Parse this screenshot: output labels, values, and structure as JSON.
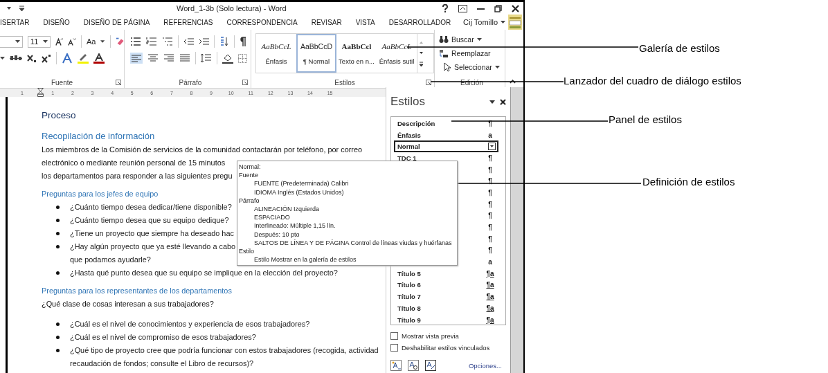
{
  "window": {
    "title": "Word_1-3b (Solo lectura) - Word"
  },
  "tabs": [
    {
      "label": "ISERTAR",
      "selected": false
    },
    {
      "label": "DISEÑO",
      "selected": false
    },
    {
      "label": "DISEÑO DE PÁGINA",
      "selected": false
    },
    {
      "label": "REFERENCIAS",
      "selected": false
    },
    {
      "label": "CORRESPONDENCIA",
      "selected": false
    },
    {
      "label": "REVISAR",
      "selected": false
    },
    {
      "label": "VISTA",
      "selected": false
    },
    {
      "label": "DESARROLLADOR",
      "selected": false
    }
  ],
  "user": {
    "name": "Cij Tomillo"
  },
  "ribbon": {
    "font_size": "11",
    "change_case": "Aa",
    "groups": [
      "Fuente",
      "Párrafo",
      "Estilos",
      "Edición"
    ],
    "gallery": [
      {
        "preview": "AaBbCcL",
        "label": "Énfasis",
        "kind": "italic",
        "selected": false
      },
      {
        "preview": "AaBbCcD",
        "label": "¶ Normal",
        "kind": "normal",
        "selected": true
      },
      {
        "preview": "AaBbCcl",
        "label": "Texto en n...",
        "kind": "bold",
        "selected": false
      },
      {
        "preview": "AaBbCcL",
        "label": "Énfasis sutil",
        "kind": "italic",
        "selected": false
      }
    ],
    "editing": [
      {
        "label": "Buscar",
        "kind": "find",
        "dropdown": true
      },
      {
        "label": "Reemplazar",
        "kind": "replace",
        "dropdown": false
      },
      {
        "label": "Seleccionar",
        "kind": "select",
        "dropdown": true
      }
    ]
  },
  "ruler": [
    "1",
    "1",
    "2",
    "3",
    "4",
    "5",
    "6",
    "7",
    "8",
    "9",
    "10",
    "11",
    "12",
    "13",
    "14",
    "15"
  ],
  "document": [
    {
      "kind": "title",
      "lines": [
        "Proceso"
      ]
    },
    {
      "kind": "heading",
      "lines": [
        "Recopilación de información"
      ]
    },
    {
      "kind": "para",
      "lines": [
        "Los miembros de la Comisión de servicios de la comunidad contactarán por teléfono, por correo",
        "electrónico o mediante reunión personal de 15 minutos",
        "los departamentos para responder a las siguientes pregu"
      ]
    },
    {
      "kind": "subheading",
      "lines": [
        "Preguntas para los jefes de equipo"
      ]
    },
    {
      "kind": "bullet",
      "lines": [
        "¿Cuánto tiempo desea dedicar/tiene disponible?"
      ]
    },
    {
      "kind": "bullet",
      "lines": [
        "¿Cuánto tiempo desea que su equipo dedique?"
      ]
    },
    {
      "kind": "bullet",
      "lines": [
        "¿Tiene un proyecto que siempre ha deseado hac"
      ]
    },
    {
      "kind": "bullet",
      "lines": [
        "¿Hay algún proyecto que ya esté llevando a cabo",
        "que podamos ayudarle?"
      ]
    },
    {
      "kind": "bullet",
      "lines": [
        "¿Hasta qué punto desea que su equipo se implique en la elección del proyecto?"
      ]
    },
    {
      "kind": "subheading",
      "lines": [
        "Preguntas para los representantes de los departamentos"
      ]
    },
    {
      "kind": "para",
      "lines": [
        "¿Qué clase de cosas interesan a sus trabajadores?"
      ]
    },
    {
      "kind": "bullet",
      "lines": [
        "¿Cuál es el nivel de conocimientos y experiencia de esos trabajadores?"
      ]
    },
    {
      "kind": "bullet",
      "lines": [
        "¿Cuál es el nivel de compromiso de esos trabajadores?"
      ]
    },
    {
      "kind": "bullet",
      "lines": [
        "¿Qué tipo de proyecto cree que podría funcionar con estos trabajadores (recogida, actividad",
        "recaudación de fondos; consulte el Libro de recursos)?"
      ]
    }
  ],
  "tooltip": {
    "title": "Normal:",
    "sections": [
      {
        "label": "Fuente",
        "children": [
          "FUENTE (Predeterminada) Calibri",
          "IDIOMA Inglés (Estados Unidos)"
        ]
      },
      {
        "label": "Párrafo",
        "children": [
          "ALINEACIÓN Izquierda",
          "ESPACIADO",
          "Interlineado:  Múltiple 1,15 lín.",
          "Después:  10 pto",
          "SALTOS DE LÍNEA Y DE PÁGINA Control de líneas viudas y huérfanas"
        ]
      },
      {
        "label": "Estilo",
        "children": [
          "Estilo Mostrar en la galería de estilos"
        ]
      }
    ]
  },
  "styles_pane": {
    "title": "Estilos",
    "items": [
      {
        "name": "Descripción",
        "mark": "¶",
        "kind": "paragraph",
        "selected": false
      },
      {
        "name": "Énfasis",
        "mark": "a",
        "kind": "character",
        "selected": false
      },
      {
        "name": "Normal",
        "kind": "paragraph",
        "selected": true
      },
      {
        "name": "TDC 1",
        "mark": "¶",
        "kind": "paragraph",
        "selected": false
      },
      {
        "mark": "¶",
        "kind": "paragraph",
        "selected": false
      },
      {
        "mark": "¶",
        "kind": "paragraph",
        "selected": false
      },
      {
        "mark": "¶",
        "kind": "paragraph",
        "selected": false
      },
      {
        "mark": "¶",
        "kind": "paragraph",
        "selected": false
      },
      {
        "mark": "¶",
        "kind": "paragraph",
        "selected": false
      },
      {
        "mark": "¶",
        "kind": "paragraph",
        "selected": false
      },
      {
        "mark": "¶",
        "kind": "paragraph",
        "selected": false
      },
      {
        "mark": "¶",
        "kind": "paragraph",
        "selected": false
      },
      {
        "mark": "a",
        "kind": "character",
        "selected": false
      },
      {
        "name": "Título 5",
        "mark": "¶a",
        "kind": "linked",
        "selected": false
      },
      {
        "name": "Título 6",
        "mark": "¶a",
        "kind": "linked",
        "selected": false
      },
      {
        "name": "Título 7",
        "mark": "¶a",
        "kind": "linked",
        "selected": false
      },
      {
        "name": "Título 8",
        "mark": "¶a",
        "kind": "linked",
        "selected": false
      },
      {
        "name": "Título 9",
        "mark": "¶a",
        "kind": "linked",
        "selected": false
      }
    ],
    "options": [
      {
        "label": "Mostrar vista previa",
        "checked": false
      },
      {
        "label": "Deshabilitar estilos vinculados",
        "checked": false
      }
    ],
    "link": "Opciones..."
  },
  "annotations": [
    {
      "label": "Galería de estilos"
    },
    {
      "label": "Lanzador del cuadro de diálogo estilos"
    },
    {
      "label": "Panel de estilos"
    },
    {
      "label": "Definición de estilos"
    }
  ]
}
